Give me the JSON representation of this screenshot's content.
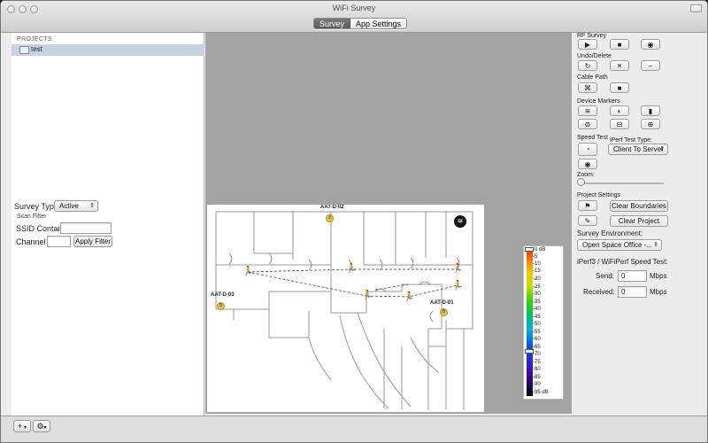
{
  "window": {
    "title": "WiFi Survey"
  },
  "tabs": [
    {
      "label": "Survey",
      "active": true
    },
    {
      "label": "App Settings",
      "active": false
    }
  ],
  "sidebar": {
    "header": "PROJECTS",
    "items": [
      {
        "label": "test",
        "selected": true
      }
    ]
  },
  "left_controls": {
    "survey_type_label": "Survey Type:",
    "survey_type_value": "Active",
    "scan_filter_label": "Scan Filter",
    "ssid_label": "SSID Contains",
    "ssid_value": "",
    "channel_label": "Channel",
    "channel_value": "",
    "apply_filter_label": "Apply Filter"
  },
  "bottom_bar": {
    "add_label": "+",
    "settings_icon": "gear-icon"
  },
  "map": {
    "labels": [
      "AAT-D-02",
      "AAT-D-03",
      "AAT-D-01"
    ],
    "marker_badges": [
      "3",
      "B",
      "B"
    ]
  },
  "scale": {
    "ticks": [
      "-0 dB",
      "-5",
      "-10",
      "-15",
      "-20",
      "-25",
      "-30",
      "-35",
      "-40",
      "-45",
      "-50",
      "-55",
      "-60",
      "-65",
      "-70",
      "-75",
      "-80",
      "-85",
      "-90",
      "-95 dB"
    ],
    "colors": {
      "top": "#ff2a00",
      "bottom": "#000000"
    }
  },
  "right_panel": {
    "rf_survey_label": "RF Survey",
    "undo_delete_label": "Undo/Delete",
    "cable_path_label": "Cable Path",
    "device_markers_label": "Device Markers",
    "speed_test_label": "Speed Test",
    "iperf_type_label": "iPerf Test Type:",
    "iperf_type_value": "Client To Server",
    "zoom_label": "Zoom:",
    "zoom_level": 0,
    "project_settings_label": "Project Settings",
    "clear_boundaries_label": "Clear Boundaries",
    "clear_project_label": "Clear Project",
    "survey_env_label": "Survey Environment:",
    "survey_env_value": "Open Space Office -...",
    "iperf_speed_label": "iPerf3 / WiFiPerf Speed Test:",
    "send_label": "Send:",
    "send_value": "0",
    "received_label": "Received:",
    "received_value": "0",
    "mbps_label": "Mbps"
  },
  "colors": {
    "selection": "#c7d2e2",
    "map_background": "#a3a3a3",
    "marker_blue": "#1f7fe0",
    "badge_yellow": "#e6c14a"
  }
}
